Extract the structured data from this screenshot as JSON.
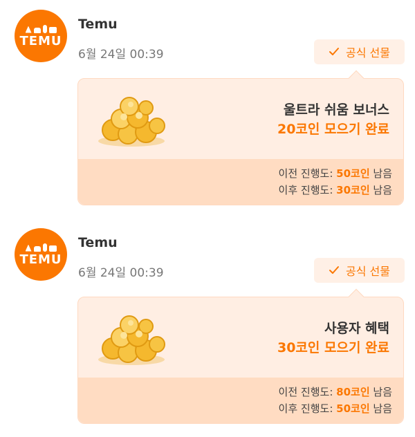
{
  "messages": [
    {
      "avatar": {
        "logo_text": "TEMU"
      },
      "sender": "Temu",
      "timestamp": "6월 24일 00:39",
      "badge": {
        "label": "공식 선물",
        "icon": "check-icon"
      },
      "card": {
        "title": "울트라 쉬움 보너스",
        "status": "20코인 모으기 완료",
        "before": {
          "label": "이전 진행도: ",
          "value": "50코인",
          "suffix": " 남음"
        },
        "after": {
          "label": "이후 진행도: ",
          "value": "30코인",
          "suffix": " 남음"
        }
      }
    },
    {
      "avatar": {
        "logo_text": "TEMU"
      },
      "sender": "Temu",
      "timestamp": "6월 24일 00:39",
      "badge": {
        "label": "공식 선물",
        "icon": "check-icon"
      },
      "card": {
        "title": "사용자 혜택",
        "status": "30코인 모으기 완료",
        "before": {
          "label": "이전 진행도: ",
          "value": "80코인",
          "suffix": " 남음"
        },
        "after": {
          "label": "이후 진행도: ",
          "value": "50코인",
          "suffix": " 남음"
        }
      }
    }
  ],
  "colors": {
    "brand": "#fb7701",
    "card_bg": "#ffeee3",
    "card_footer": "#ffdcc2",
    "badge_bg": "#fff0e6"
  }
}
